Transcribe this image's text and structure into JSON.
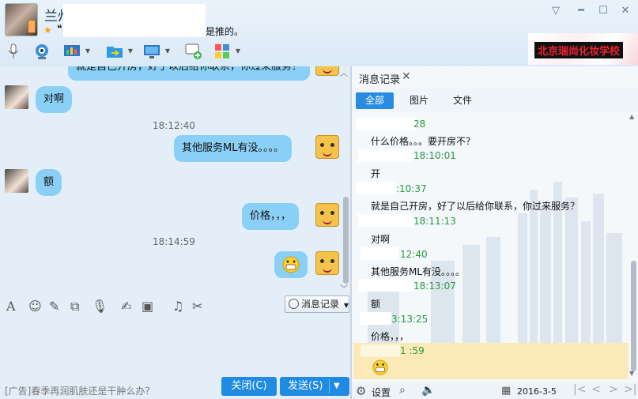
{
  "header": {
    "contact_name": "兰州",
    "signature": "是推的。",
    "status_mark": "❝"
  },
  "window_controls": {
    "chevron": "▽",
    "minimize": "━",
    "maximize": "☐",
    "close": "✕"
  },
  "logo_text": "北京瑞尚化妆学校",
  "chat": {
    "top_partial_message": "就是自己开房，好了以后给你联系，你过来服务？",
    "messages": [
      {
        "side": "left",
        "text": "对啊"
      },
      {
        "time": "18:12:40"
      },
      {
        "side": "right",
        "text": "其他服务ML有没。。。。"
      },
      {
        "side": "left",
        "text": "额"
      },
      {
        "side": "right",
        "text": "价格，，，"
      },
      {
        "time": "18:14:59"
      },
      {
        "side": "right",
        "emoji": "grin"
      }
    ]
  },
  "input": {
    "history_button_label": "消息记录",
    "ad_text": "[广告]春季再润肌肤还是干肿么办？",
    "close_label": "关闭(C)",
    "send_label": "发送(S)"
  },
  "history": {
    "title": "消息记录",
    "tabs": [
      "全部",
      "图片",
      "文件"
    ],
    "active_tab": "全部",
    "entries": [
      {
        "time": "28",
        "text": "什么价格。。。要开房不？"
      },
      {
        "time": "18:10:01",
        "text": "开"
      },
      {
        "time": ":10:37",
        "text": "就是自己开房，好了以后给你联系，你过来服务？"
      },
      {
        "time": "18:11:13",
        "text": "对啊"
      },
      {
        "time": "12:40",
        "text": "其他服务ML有没。。。。"
      },
      {
        "time": "18:13:07",
        "text": "额"
      },
      {
        "time": "3:13:25",
        "text": "价格，，，"
      },
      {
        "time": "1  :59",
        "text": ""
      }
    ],
    "settings_label": "设置",
    "date": "2016-3-5"
  },
  "colors": {
    "bubble": "#8ad0f6",
    "accent": "#1f8be2",
    "time_green": "#2a9a44",
    "highlight": "#fbeab7"
  }
}
